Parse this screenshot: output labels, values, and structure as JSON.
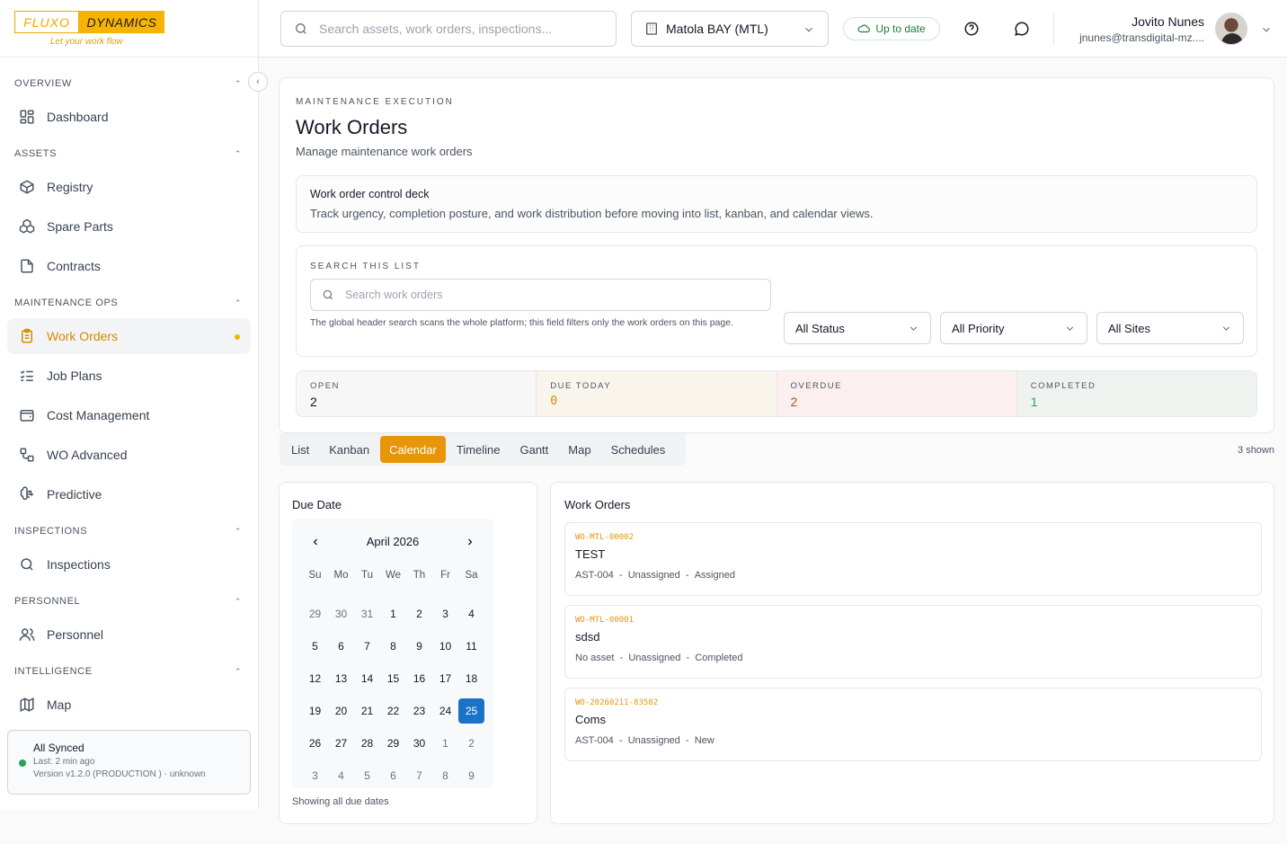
{
  "logo": {
    "part1": "FLUXO",
    "part2": "DYNAMICS",
    "tagline": "Let your work flow"
  },
  "sidebar": {
    "sections": [
      {
        "label": "OVERVIEW",
        "items": [
          {
            "label": "Dashboard",
            "icon": "grid-icon"
          }
        ]
      },
      {
        "label": "ASSETS",
        "items": [
          {
            "label": "Registry",
            "icon": "cube-icon"
          },
          {
            "label": "Spare Parts",
            "icon": "boxes-icon"
          },
          {
            "label": "Contracts",
            "icon": "document-icon"
          }
        ]
      },
      {
        "label": "MAINTENANCE OPS",
        "items": [
          {
            "label": "Work Orders",
            "icon": "clipboard-icon",
            "active": true
          },
          {
            "label": "Job Plans",
            "icon": "checklist-icon"
          },
          {
            "label": "Cost Management",
            "icon": "wallet-icon"
          },
          {
            "label": "WO Advanced",
            "icon": "workflow-icon"
          },
          {
            "label": "Predictive",
            "icon": "brain-icon"
          }
        ]
      },
      {
        "label": "INSPECTIONS",
        "items": [
          {
            "label": "Inspections",
            "icon": "search-icon"
          }
        ]
      },
      {
        "label": "PERSONNEL",
        "items": [
          {
            "label": "Personnel",
            "icon": "users-icon"
          }
        ]
      },
      {
        "label": "INTELLIGENCE",
        "items": [
          {
            "label": "Map",
            "icon": "map-icon"
          }
        ]
      }
    ],
    "sync": {
      "status": "All Synced",
      "last": "Last: 2 min ago",
      "version": "Version v1.2.0 (PRODUCTION ) · unknown"
    }
  },
  "header": {
    "search_placeholder": "Search assets, work orders, inspections...",
    "site": "Matola BAY (MTL)",
    "sync_status": "Up to date",
    "user_name": "Jovito Nunes",
    "user_email": "jnunes@transdigital-mz...."
  },
  "page": {
    "eyebrow": "MAINTENANCE EXECUTION",
    "title": "Work Orders",
    "subtitle": "Manage maintenance work orders",
    "deck_title": "Work order control deck",
    "deck_desc": "Track urgency, completion posture, and work distribution before moving into list, kanban, and calendar views.",
    "search_label": "SEARCH THIS LIST",
    "search_placeholder": "Search work orders",
    "search_hint": "The global header search scans the whole platform; this field filters only the work orders on this page.",
    "filters": {
      "status": "All Status",
      "priority": "All Priority",
      "sites": "All Sites"
    },
    "stats": [
      {
        "label": "OPEN",
        "value": "2"
      },
      {
        "label": "DUE TODAY",
        "value": "0"
      },
      {
        "label": "OVERDUE",
        "value": "2"
      },
      {
        "label": "COMPLETED",
        "value": "1"
      }
    ],
    "tabs": [
      "List",
      "Kanban",
      "Calendar",
      "Timeline",
      "Gantt",
      "Map",
      "Schedules"
    ],
    "active_tab": "Calendar",
    "shown": "3 shown"
  },
  "calendar": {
    "title": "Due Date",
    "month": "April 2026",
    "weekdays": [
      "Su",
      "Mo",
      "Tu",
      "We",
      "Th",
      "Fr",
      "Sa"
    ],
    "days": [
      [
        "29",
        "30",
        "31",
        "1",
        "2",
        "3",
        "4"
      ],
      [
        "5",
        "6",
        "7",
        "8",
        "9",
        "10",
        "11"
      ],
      [
        "12",
        "13",
        "14",
        "15",
        "16",
        "17",
        "18"
      ],
      [
        "19",
        "20",
        "21",
        "22",
        "23",
        "24",
        "25"
      ],
      [
        "26",
        "27",
        "28",
        "29",
        "30",
        "1",
        "2"
      ],
      [
        "3",
        "4",
        "5",
        "6",
        "7",
        "8",
        "9"
      ]
    ],
    "muted": [
      [
        0,
        0
      ],
      [
        0,
        1
      ],
      [
        0,
        2
      ],
      [
        4,
        5
      ],
      [
        4,
        6
      ],
      [
        5,
        0
      ],
      [
        5,
        1
      ],
      [
        5,
        2
      ],
      [
        5,
        3
      ],
      [
        5,
        4
      ],
      [
        5,
        5
      ],
      [
        5,
        6
      ]
    ],
    "selected": [
      3,
      6
    ],
    "footer": "Showing all due dates"
  },
  "work_orders": {
    "title": "Work Orders",
    "items": [
      {
        "code": "WO-MTL-00002",
        "name": "TEST",
        "asset": "AST-004",
        "assignee": "Unassigned",
        "status": "Assigned"
      },
      {
        "code": "WO-MTL-00001",
        "name": "sdsd",
        "asset": "No asset",
        "assignee": "Unassigned",
        "status": "Completed"
      },
      {
        "code": "WO-20260211-83582",
        "name": "Coms",
        "asset": "AST-004",
        "assignee": "Unassigned",
        "status": "New"
      }
    ]
  },
  "colors": {
    "accent": "#e8950a",
    "selected_day": "#1a73c7",
    "synced": "#22a55a"
  }
}
